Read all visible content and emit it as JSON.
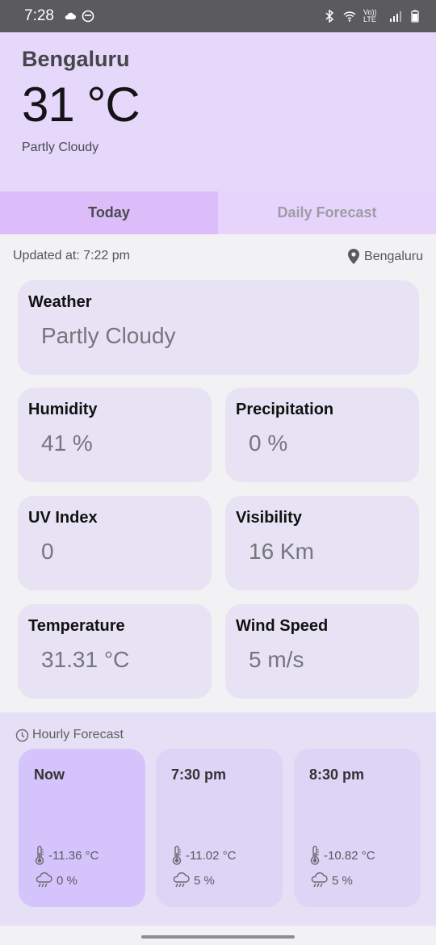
{
  "status": {
    "time": "7:28",
    "lte_label": "Vo)) LTE"
  },
  "header": {
    "city": "Bengaluru",
    "temperature": "31 °C",
    "condition": "Partly Cloudy"
  },
  "tabs": [
    {
      "label": "Today",
      "selected": true
    },
    {
      "label": "Daily Forecast",
      "selected": false
    }
  ],
  "updated": {
    "text": "Updated at: 7:22 pm",
    "location": "Bengaluru"
  },
  "cards": {
    "weather": {
      "label": "Weather",
      "value": "Partly Cloudy"
    },
    "humidity": {
      "label": "Humidity",
      "value": "41 %"
    },
    "precipitation": {
      "label": "Precipitation",
      "value": "0 %"
    },
    "uv": {
      "label": "UV Index",
      "value": "0"
    },
    "visibility": {
      "label": "Visibility",
      "value": "16 Km"
    },
    "temperature": {
      "label": "Temperature",
      "value": "31.31 °C"
    },
    "wind": {
      "label": "Wind Speed",
      "value": "5 m/s"
    }
  },
  "hourly": {
    "title": "Hourly Forecast",
    "items": [
      {
        "time": "Now",
        "temp": "-11.36 °C",
        "rain": "0 %"
      },
      {
        "time": "7:30 pm",
        "temp": "-11.02 °C",
        "rain": "5 %"
      },
      {
        "time": "8:30 pm",
        "temp": "-10.82 °C",
        "rain": "5 %"
      }
    ]
  },
  "colors": {
    "header_bg": "#e5d8fb",
    "tab_selected": "#dcbdfa",
    "card_bg": "#e7e3f4",
    "hourly_now_bg": "#d5c4fc"
  }
}
